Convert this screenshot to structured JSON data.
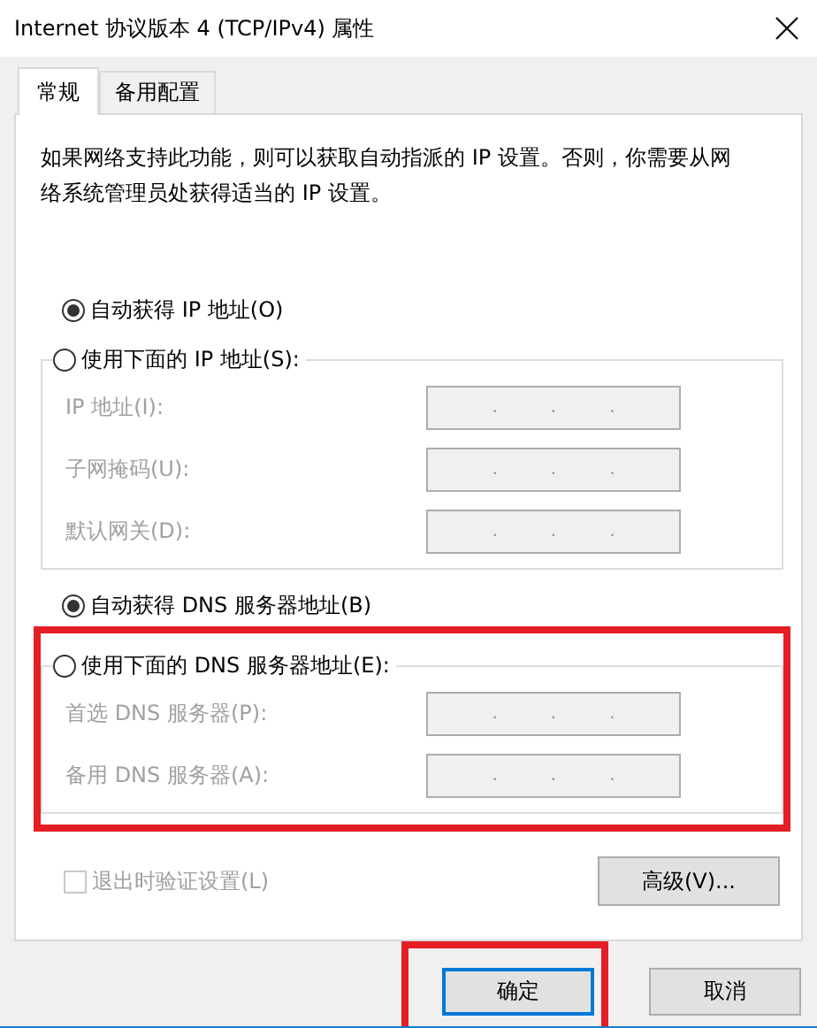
{
  "window": {
    "title": "Internet 协议版本 4 (TCP/IPv4) 属性"
  },
  "tabs": [
    {
      "label": "常规",
      "selected": true
    },
    {
      "label": "备用配置",
      "selected": false
    }
  ],
  "description": "如果网络支持此功能，则可以获取自动指派的 IP 设置。否则，你需要从网络系统管理员处获得适当的 IP 设置。",
  "ip_mode": [
    {
      "label": "自动获得 IP 地址(O)",
      "selected": true
    },
    {
      "label": "使用下面的 IP 地址(S):",
      "selected": false
    }
  ],
  "ip_group": {
    "highlighted": false,
    "fields": [
      {
        "label": "IP 地址(I):",
        "disabled": true,
        "separators": [
          ".",
          ".",
          "."
        ]
      },
      {
        "label": "子网掩码(U):",
        "disabled": true,
        "separators": [
          ".",
          ".",
          "."
        ]
      },
      {
        "label": "默认网关(D):",
        "disabled": true,
        "separators": [
          ".",
          ".",
          "."
        ]
      }
    ]
  },
  "dns_mode": [
    {
      "label": "自动获得 DNS 服务器地址(B)",
      "selected": true
    },
    {
      "label": "使用下面的 DNS 服务器地址(E):",
      "selected": false
    }
  ],
  "dns_group": {
    "highlighted": true,
    "fields": [
      {
        "label": "首选 DNS 服务器(P):",
        "disabled": true,
        "separators": [
          ".",
          ".",
          "."
        ]
      },
      {
        "label": "备用 DNS 服务器(A):",
        "disabled": true,
        "separators": [
          ".",
          ".",
          "."
        ]
      }
    ]
  },
  "checkbox": {
    "label": "退出时验证设置(L)",
    "checked": false,
    "disabled": true
  },
  "advanced_button": "高级(V)...",
  "buttons": [
    {
      "label": "确定",
      "default": true,
      "highlighted": true
    },
    {
      "label": "取消",
      "default": false,
      "highlighted": false
    }
  ]
}
